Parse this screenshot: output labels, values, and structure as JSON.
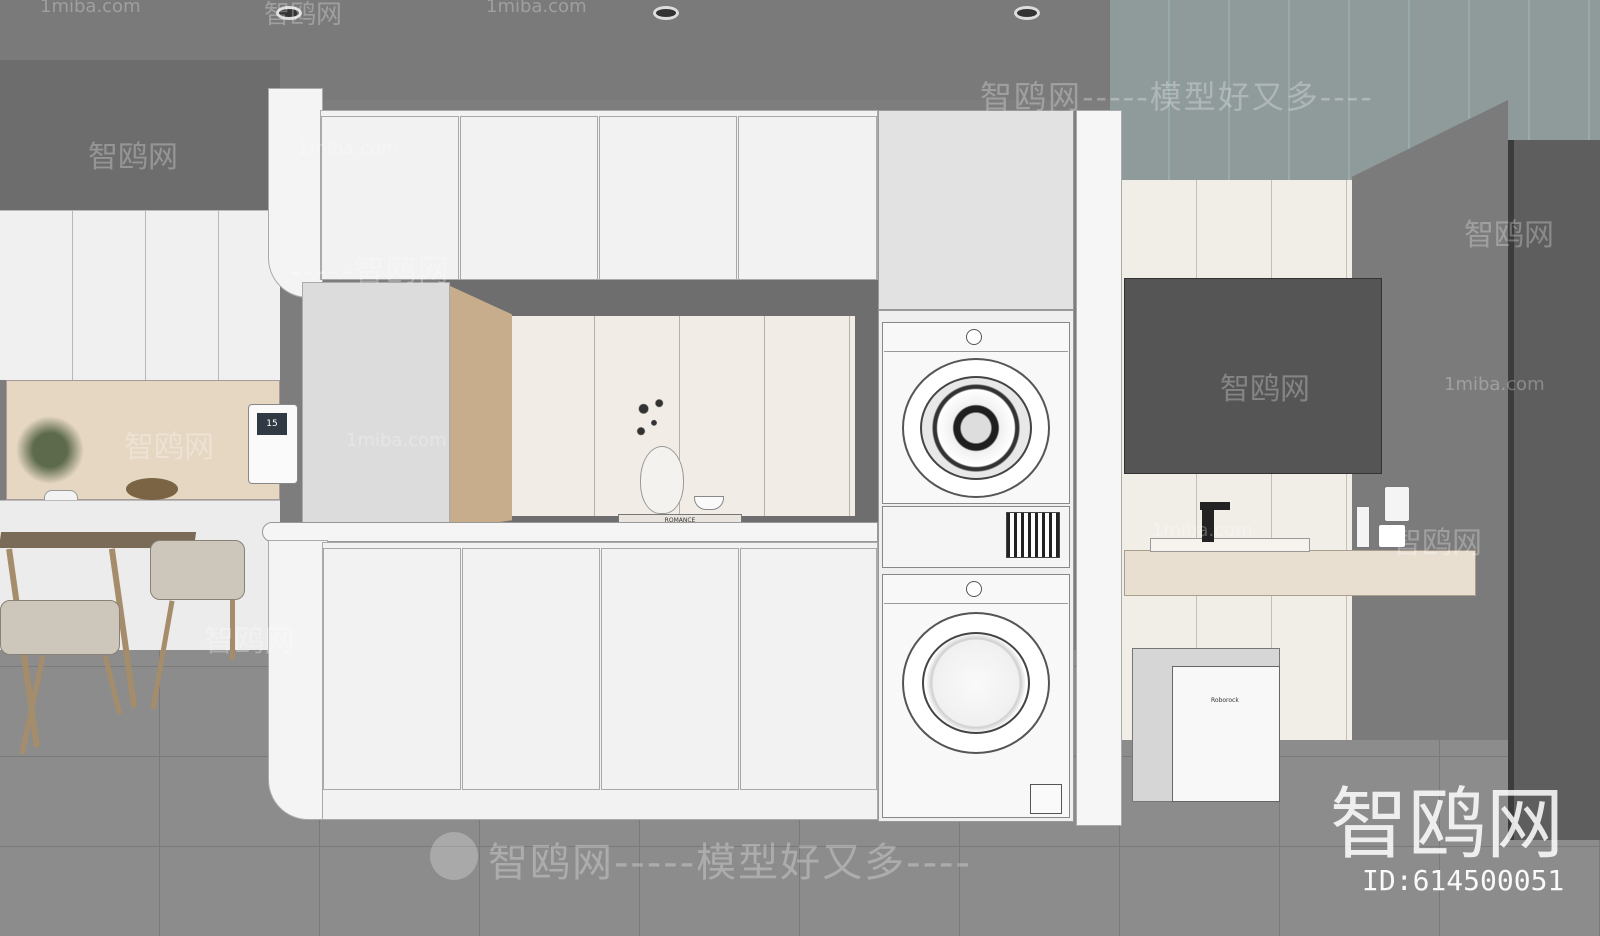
{
  "scene": {
    "colors": {
      "ceiling": "#7a7a7a",
      "floor": "#8a8a8a",
      "cabinet": "#f2f2f2",
      "wood": "#d8c3a8",
      "tv": "#555555",
      "counter": "#e8dfd1"
    }
  },
  "watermarks": {
    "top_left_site": "1miba.com",
    "top_brand": "智鸥网",
    "top_site2": "1miba.com",
    "upper_right": "智鸥网-----模型好又多----",
    "left_brand": "智鸥网",
    "left_site": "1miba.com",
    "mid_brand": "-----智鸥网",
    "tv_brand": "智鸥网",
    "tv_site": "1miba.com",
    "right_brand": "智鸥网",
    "dining_brand": "智鸥网",
    "dining_site": "1miba.com",
    "sink_brand": "智鸥网",
    "sink_site": "1miba.com",
    "chair_brand": "智鸥网",
    "bottom_main": "智鸥网-----模型好又多----",
    "big_logo": "智鸥网",
    "id_label": "ID:614500051"
  },
  "appliances": {
    "water_dispenser_display": "15",
    "book_title": "ROMANCE",
    "robot_brand": "Roborock"
  }
}
